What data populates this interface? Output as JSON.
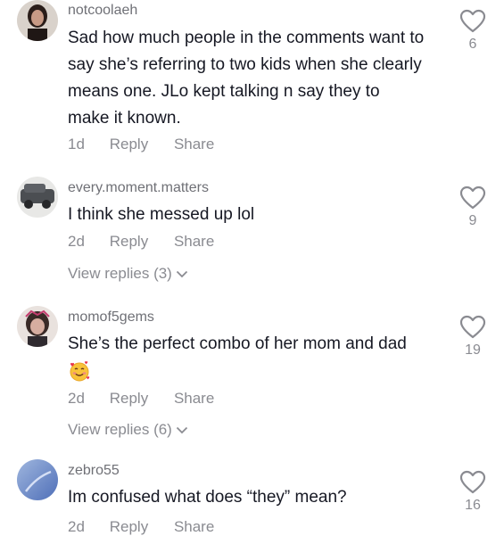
{
  "comments": [
    {
      "username": "notcoolaeh",
      "text": "Sad how much people in the comments want to say she’s referring to two kids when she clearly means one. JLo kept talking n say they to make it known.",
      "date": "1d",
      "reply": "Reply",
      "share": "Share",
      "likes": "6"
    },
    {
      "username": "every.moment.matters",
      "text": "I think she messed up lol",
      "date": "2d",
      "reply": "Reply",
      "share": "Share",
      "view_replies": "View replies (3)",
      "likes": "9"
    },
    {
      "username": "momof5gems",
      "text": "She’s the perfect combo of her mom and dad",
      "emoji": "smiling-face-with-hearts",
      "date": "2d",
      "reply": "Reply",
      "share": "Share",
      "view_replies": "View replies (6)",
      "likes": "19"
    },
    {
      "username": "zebro55",
      "text": "Im confused what does “they” mean?",
      "date": "2d",
      "reply": "Reply",
      "share": "Share",
      "likes": "16"
    }
  ],
  "colors": {
    "text_primary": "#161823",
    "text_secondary": "#8a8b91",
    "icon": "#8a8b91"
  }
}
